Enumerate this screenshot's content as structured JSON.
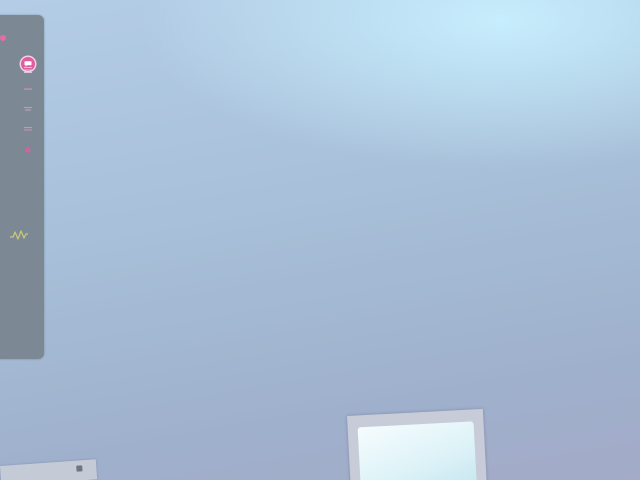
{
  "accent_color": "#e05da3",
  "sidebar": {
    "background_color": "#7d8895",
    "items": [
      {
        "icon": "close-icon"
      },
      {
        "icon": "chat-bubble-icon",
        "active": true
      },
      {
        "icon": "list-icon"
      },
      {
        "icon": "minus-icon"
      },
      {
        "icon": "bookmark-icon"
      },
      {
        "icon": "image-icon"
      },
      {
        "icon": "gear-icon"
      },
      {
        "icon": "waveform-icon"
      }
    ]
  },
  "window_frame": {
    "icon": "window-frame"
  },
  "tray": {
    "icon": "tray-handle-icon"
  }
}
